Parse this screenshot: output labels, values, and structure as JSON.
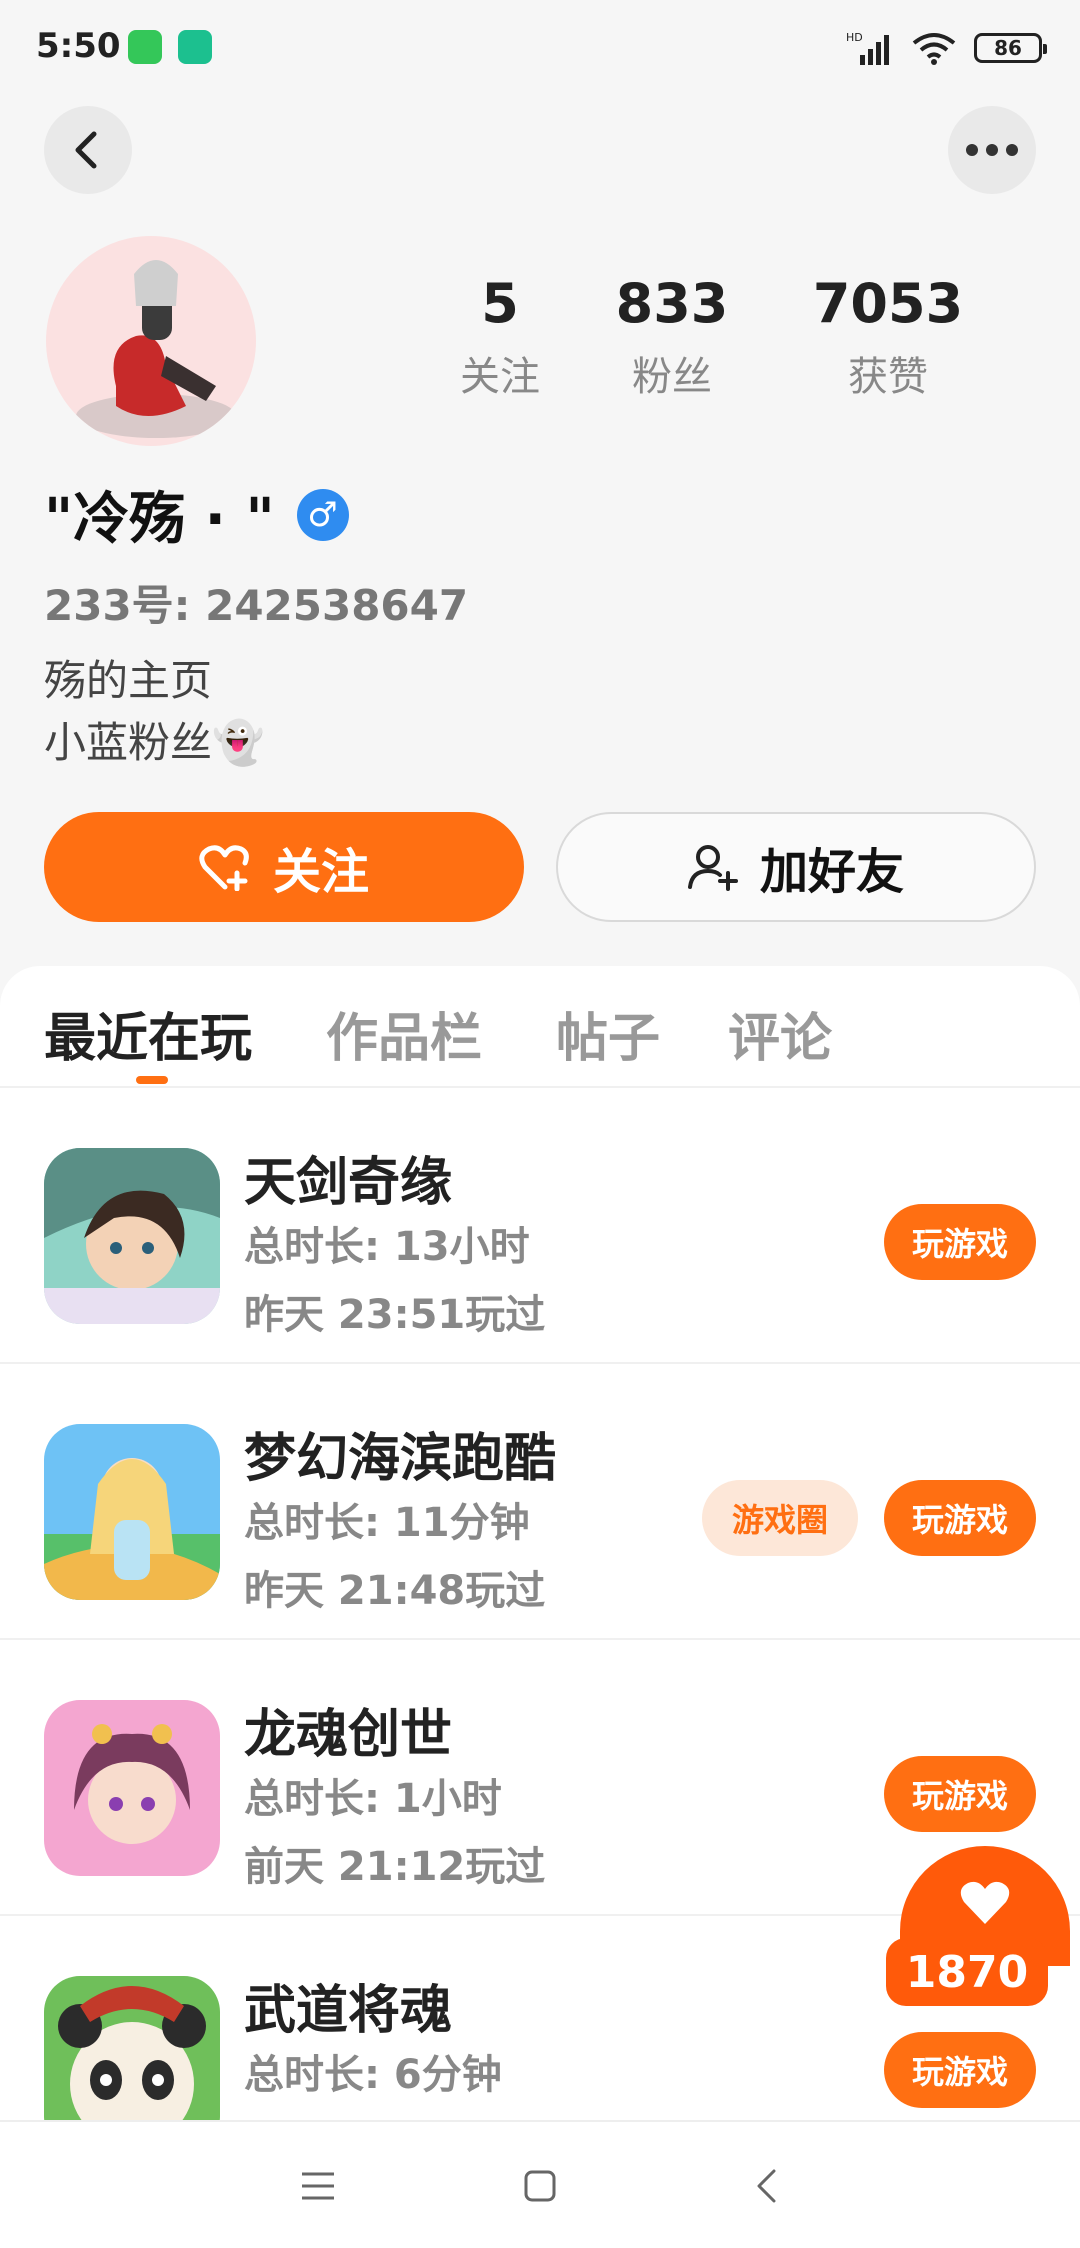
{
  "status_bar": {
    "time": "5:50",
    "network": "HD",
    "battery": "86"
  },
  "profile": {
    "nickname": "\"冷殇 · \"",
    "gender_symbol": "♂",
    "user_id": "233号: 242538647",
    "bio_line1": "殇的主页",
    "bio_line2": "小蓝粉丝👻",
    "stats": [
      {
        "num": "5",
        "label": "关注"
      },
      {
        "num": "833",
        "label": "粉丝"
      },
      {
        "num": "7053",
        "label": "获赞"
      }
    ],
    "follow_label": "关注",
    "add_friend_label": "加好友"
  },
  "tabs": [
    {
      "label": "最近在玩",
      "active": true
    },
    {
      "label": "作品栏",
      "active": false
    },
    {
      "label": "帖子",
      "active": false
    },
    {
      "label": "评论",
      "active": false
    }
  ],
  "games": [
    {
      "title": "天剑奇缘",
      "duration": "总时长: 13小时",
      "last_played": "昨天 23:51玩过",
      "play_label": "玩游戏",
      "colors": [
        "#8fd3c6",
        "#f3c9a0"
      ]
    },
    {
      "title": "梦幻海滨跑酷",
      "duration": "总时长: 11分钟",
      "last_played": "昨天 21:48玩过",
      "play_label": "玩游戏",
      "circle_label": "游戏圈",
      "colors": [
        "#6ec2f5",
        "#f6d57a"
      ]
    },
    {
      "title": "龙魂创世",
      "duration": "总时长: 1小时",
      "last_played": "前天 21:12玩过",
      "play_label": "玩游戏",
      "colors": [
        "#f4a6d0",
        "#7a3b5e"
      ]
    },
    {
      "title": "武道将魂",
      "duration": "总时长: 6分钟",
      "last_played": "",
      "play_label": "玩游戏",
      "colors": [
        "#6fbf5a",
        "#f7efe2"
      ]
    }
  ],
  "floating_like": {
    "count": "1870"
  },
  "accent_color": "#ff6f12"
}
